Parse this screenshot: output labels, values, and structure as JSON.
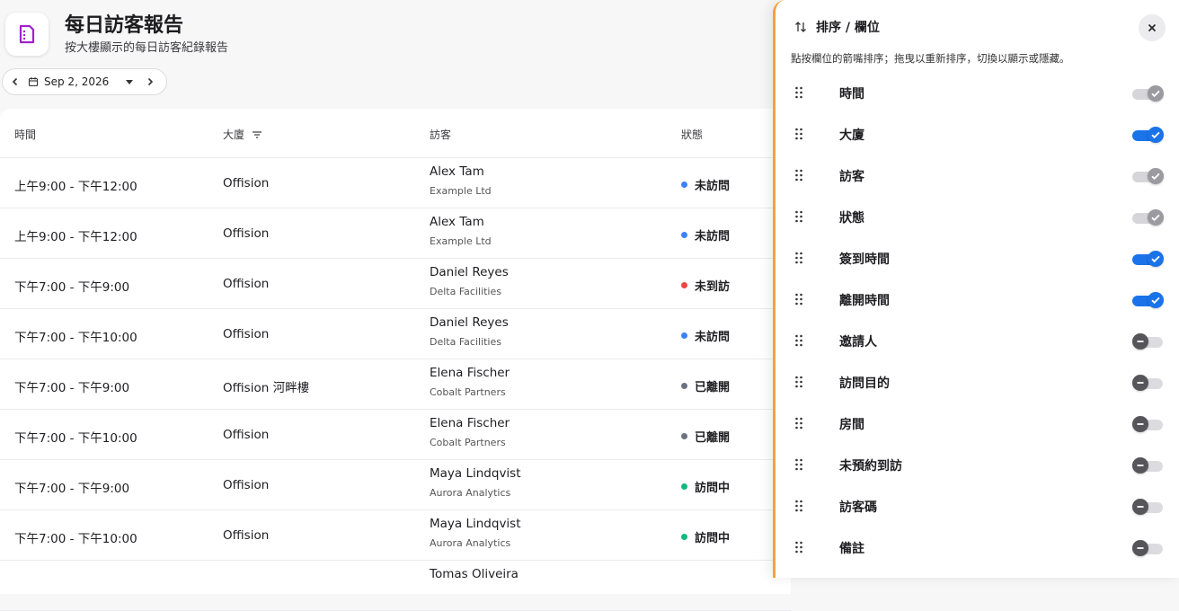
{
  "header": {
    "title": "每日訪客報告",
    "subtitle": "按大樓顯示的每日訪客紀錄報告",
    "icon": "document-icon"
  },
  "date_picker": {
    "value": "Sep 2, 2026"
  },
  "table": {
    "columns": [
      "時間",
      "大廈",
      "訪客",
      "狀態"
    ],
    "rows": [
      {
        "time": "上午9:00 - 下午12:00",
        "building": "Offision",
        "visitor": "Alex Tam",
        "company": "Example Ltd",
        "status": "未訪問",
        "status_color": "#3b82f6"
      },
      {
        "time": "上午9:00 - 下午12:00",
        "building": "Offision",
        "visitor": "Alex Tam",
        "company": "Example Ltd",
        "status": "未訪問",
        "status_color": "#3b82f6"
      },
      {
        "time": "下午7:00 - 下午9:00",
        "building": "Offision",
        "visitor": "Daniel Reyes",
        "company": "Delta Facilities",
        "status": "未到訪",
        "status_color": "#ef4444"
      },
      {
        "time": "下午7:00 - 下午10:00",
        "building": "Offision",
        "visitor": "Daniel Reyes",
        "company": "Delta Facilities",
        "status": "未訪問",
        "status_color": "#3b82f6"
      },
      {
        "time": "下午7:00 - 下午9:00",
        "building": "Offision 河畔樓",
        "visitor": "Elena Fischer",
        "company": "Cobalt Partners",
        "status": "已離開",
        "status_color": "#6b7280"
      },
      {
        "time": "下午7:00 - 下午10:00",
        "building": "Offision",
        "visitor": "Elena Fischer",
        "company": "Cobalt Partners",
        "status": "已離開",
        "status_color": "#6b7280"
      },
      {
        "time": "下午7:00 - 下午9:00",
        "building": "Offision",
        "visitor": "Maya Lindqvist",
        "company": "Aurora Analytics",
        "status": "訪問中",
        "status_color": "#10b981"
      },
      {
        "time": "下午7:00 - 下午10:00",
        "building": "Offision",
        "visitor": "Maya Lindqvist",
        "company": "Aurora Analytics",
        "status": "訪問中",
        "status_color": "#10b981"
      },
      {
        "time": "",
        "building": "",
        "visitor": "Tomas Oliveira",
        "company": "",
        "status": "",
        "status_color": "#ffffff"
      }
    ]
  },
  "panel": {
    "title": "排序 / 欄位",
    "hint": "點按欄位的箭嘴排序；拖曳以重新排序，切換以顯示或隱藏。",
    "colors": {
      "on": "#1a73e8",
      "locked": "#9a9aa0",
      "off": "#55555a",
      "accent_border": "#f2a33a"
    },
    "columns": [
      {
        "label": "時間",
        "state": "locked"
      },
      {
        "label": "大廈",
        "state": "on"
      },
      {
        "label": "訪客",
        "state": "locked"
      },
      {
        "label": "狀態",
        "state": "locked"
      },
      {
        "label": "簽到時間",
        "state": "on"
      },
      {
        "label": "離開時間",
        "state": "on"
      },
      {
        "label": "邀請人",
        "state": "off"
      },
      {
        "label": "訪問目的",
        "state": "off"
      },
      {
        "label": "房間",
        "state": "off"
      },
      {
        "label": "未預約到訪",
        "state": "off"
      },
      {
        "label": "訪客碼",
        "state": "off"
      },
      {
        "label": "備註",
        "state": "off"
      }
    ]
  }
}
